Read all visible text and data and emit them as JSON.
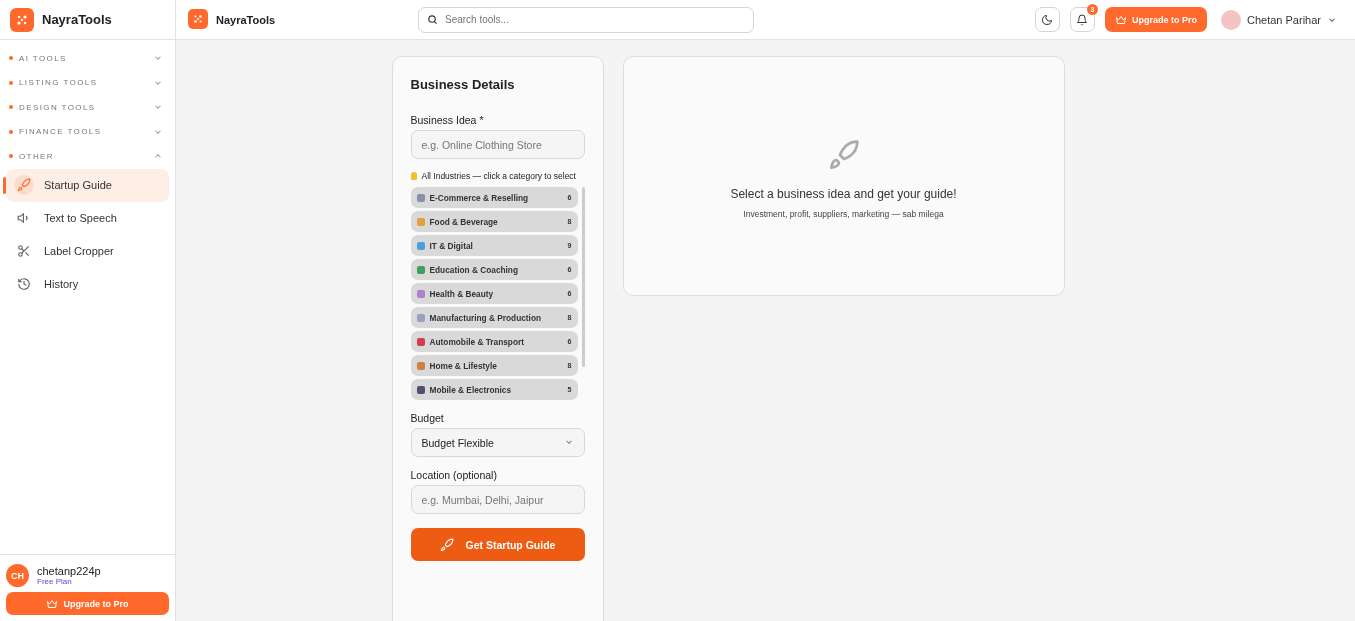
{
  "sidebar": {
    "brand": "NayraTools",
    "groups": [
      {
        "label": "AI TOOLS",
        "expanded": false
      },
      {
        "label": "LISTING TOOLS",
        "expanded": false
      },
      {
        "label": "DESIGN TOOLS",
        "expanded": false
      },
      {
        "label": "FINANCE TOOLS",
        "expanded": false
      },
      {
        "label": "OTHER",
        "expanded": true,
        "items": [
          {
            "label": "Startup Guide",
            "kind": "rocket",
            "selected": true
          },
          {
            "label": "Text to Speech",
            "kind": "speaker",
            "selected": false
          },
          {
            "label": "Label Cropper",
            "kind": "scissors",
            "selected": false
          },
          {
            "label": "History",
            "kind": "history",
            "selected": false
          }
        ]
      }
    ],
    "user": {
      "initials": "CH",
      "name": "chetanp224p",
      "plan": "Free Plan"
    },
    "upgrade_button": "Upgrade to Pro"
  },
  "topbar": {
    "brand": "NayraTools",
    "search": {
      "placeholder": "Search tools..."
    },
    "notification_count": "3",
    "upgrade_button": "Upgrade to Pro",
    "user_name": "Chetan Parihar"
  },
  "form": {
    "title": "Business Details",
    "idea": {
      "label": "Business Idea *",
      "placeholder": "e.g. Online Clothing Store"
    },
    "hint": "All Industries — click a category to select",
    "categories": [
      {
        "label": "E-Commerce & Reselling",
        "count": "6",
        "color": "#8a8fa8"
      },
      {
        "label": "Food & Beverage",
        "count": "8",
        "color": "#e0a040"
      },
      {
        "label": "IT & Digital",
        "count": "9",
        "color": "#4aa0e0"
      },
      {
        "label": "Education & Coaching",
        "count": "6",
        "color": "#40a060"
      },
      {
        "label": "Health & Beauty",
        "count": "6",
        "color": "#b080d0"
      },
      {
        "label": "Manufacturing & Production",
        "count": "8",
        "color": "#9aa0c0"
      },
      {
        "label": "Automobile & Transport",
        "count": "6",
        "color": "#d04050"
      },
      {
        "label": "Home & Lifestyle",
        "count": "8",
        "color": "#d08040"
      },
      {
        "label": "Mobile & Electronics",
        "count": "5",
        "color": "#505070"
      }
    ],
    "budget": {
      "label": "Budget",
      "value": "Budget Flexible"
    },
    "location": {
      "label": "Location (optional)",
      "placeholder": "e.g. Mumbai, Delhi, Jaipur"
    },
    "submit": "Get Startup Guide"
  },
  "result": {
    "title": "Select a business idea and get your guide!",
    "subtitle": "Investment, profit, suppliers, marketing — sab milega"
  }
}
